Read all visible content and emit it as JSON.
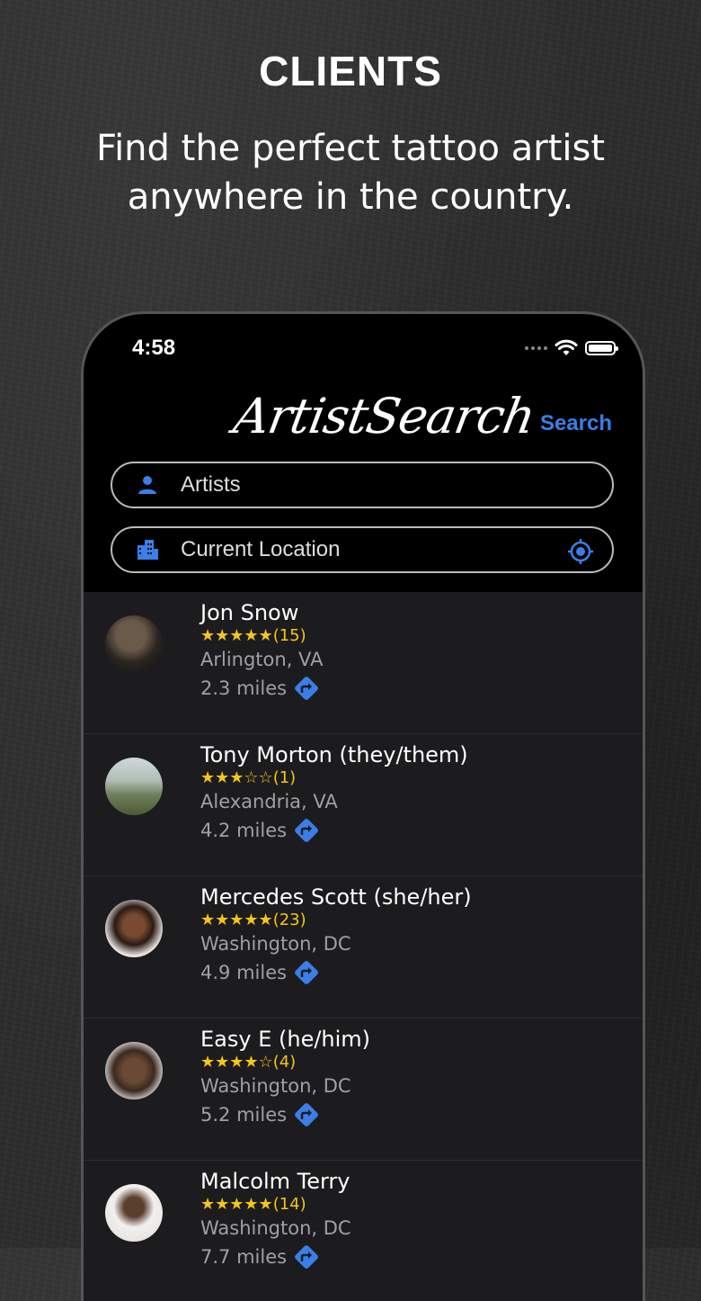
{
  "promo": {
    "title": "CLIENTS",
    "subtitle": "Find the perfect tattoo artist anywhere in the country."
  },
  "status": {
    "time": "4:58"
  },
  "header": {
    "logo": "ArtistSearch",
    "search_label": "Search"
  },
  "fields": {
    "artists": "Artists",
    "location": "Current Location"
  },
  "colors": {
    "accent": "#3b7ee8",
    "star": "#f5c518",
    "row_bg": "#1c1c1e"
  },
  "artists": [
    {
      "name": "Jon Snow",
      "stars": "★★★★★",
      "count": "(15)",
      "location": "Arlington, VA",
      "distance": "2.3 miles"
    },
    {
      "name": "Tony Morton (they/them)",
      "stars": "★★★☆☆",
      "count": "(1)",
      "location": "Alexandria, VA",
      "distance": "4.2 miles"
    },
    {
      "name": "Mercedes Scott (she/her)",
      "stars": "★★★★★",
      "count": "(23)",
      "location": "Washington, DC",
      "distance": "4.9 miles"
    },
    {
      "name": "Easy E (he/him)",
      "stars": "★★★★☆",
      "count": "(4)",
      "location": "Washington, DC",
      "distance": "5.2 miles"
    },
    {
      "name": "Malcolm Terry",
      "stars": "★★★★★",
      "count": "(14)",
      "location": "Washington, DC",
      "distance": "7.7 miles"
    }
  ]
}
